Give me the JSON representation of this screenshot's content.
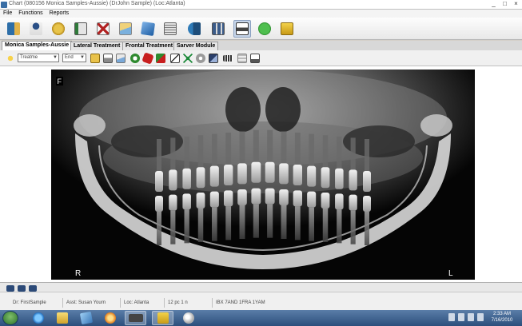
{
  "window": {
    "title": "Chart (080156  Monica Samples-Aussie) (DrJohn Sample) (Loc:Atlanta)",
    "controls": [
      "_",
      "□",
      "×"
    ]
  },
  "menu": [
    "File",
    "Functions",
    "Reports"
  ],
  "toolbar_main": {
    "icons": [
      "exit-door-icon",
      "patient-icon",
      "hand-icon",
      "notebook-icon",
      "document-x-icon",
      "envelope-icon",
      "blue-panel-icon",
      "ledger-icon",
      "teeth-icon",
      "stack-icon",
      "image-viewer-icon",
      "back-arrow-icon",
      "folder-icon"
    ],
    "selected_index": 10
  },
  "tabs": [
    {
      "label": "Monica Samples-Aussie",
      "active": true
    },
    {
      "label": "Lateral Treatment",
      "active": false
    },
    {
      "label": "Frontal Treatment",
      "active": false
    },
    {
      "label": "Sarver Module",
      "active": false
    }
  ],
  "toolbar_image": {
    "selects": [
      {
        "value": "Treatme"
      },
      {
        "value": "End"
      }
    ],
    "icons": [
      "new-image-icon",
      "print-icon",
      "scanner-icon",
      "mail-icon",
      "rotate-icon",
      "delete-icon",
      "move-icon",
      "crop-icon",
      "fit-icon",
      "settings-icon",
      "contrast-icon",
      "film-icon",
      "grid-icon",
      "export-icon"
    ]
  },
  "xray": {
    "marker_top_left": "F",
    "marker_bottom_left": "R",
    "marker_bottom_right": "L"
  },
  "status": {
    "fields": [
      "Dr: FirstSample",
      "Asst: Susan Yourn",
      "Loc: Atlanta",
      "12 pc 1 n",
      "IBX 7AND 1FRA 1YAM"
    ]
  },
  "taskbar": {
    "clock_time": "2:33 AM",
    "clock_date": "7/16/2010"
  },
  "colors": {
    "toolbar_selected": "#c7d6ea",
    "taskbar": "#2c4f7c"
  }
}
